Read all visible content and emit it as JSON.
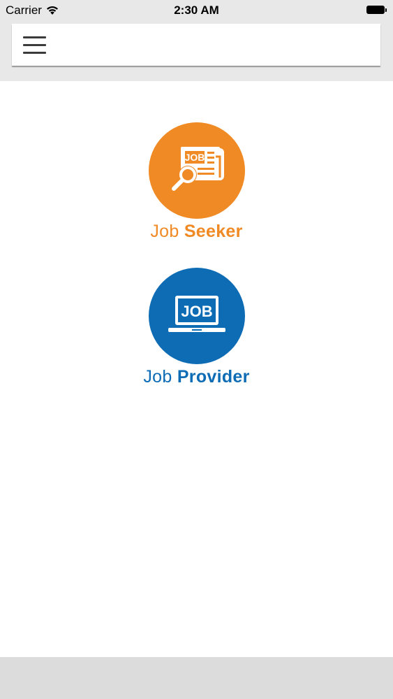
{
  "status_bar": {
    "carrier": "Carrier",
    "time": "2:30 AM",
    "wifi_icon": "wifi-icon",
    "battery_icon": "battery-icon"
  },
  "app_bar": {
    "menu_icon": "hamburger-menu-icon"
  },
  "options": {
    "seeker": {
      "label_light": "Job",
      "label_bold": "Seeker",
      "icon_text": "JOB",
      "icon": "job-search-newspaper-icon",
      "color": "#f08a24"
    },
    "provider": {
      "label_light": "Job",
      "label_bold": "Provider",
      "icon_text": "JOB",
      "icon": "laptop-job-icon",
      "color": "#0e6cb5"
    }
  },
  "colors": {
    "header_bg": "#e8e8e9",
    "bottom_bar_bg": "#dcdcdd"
  }
}
